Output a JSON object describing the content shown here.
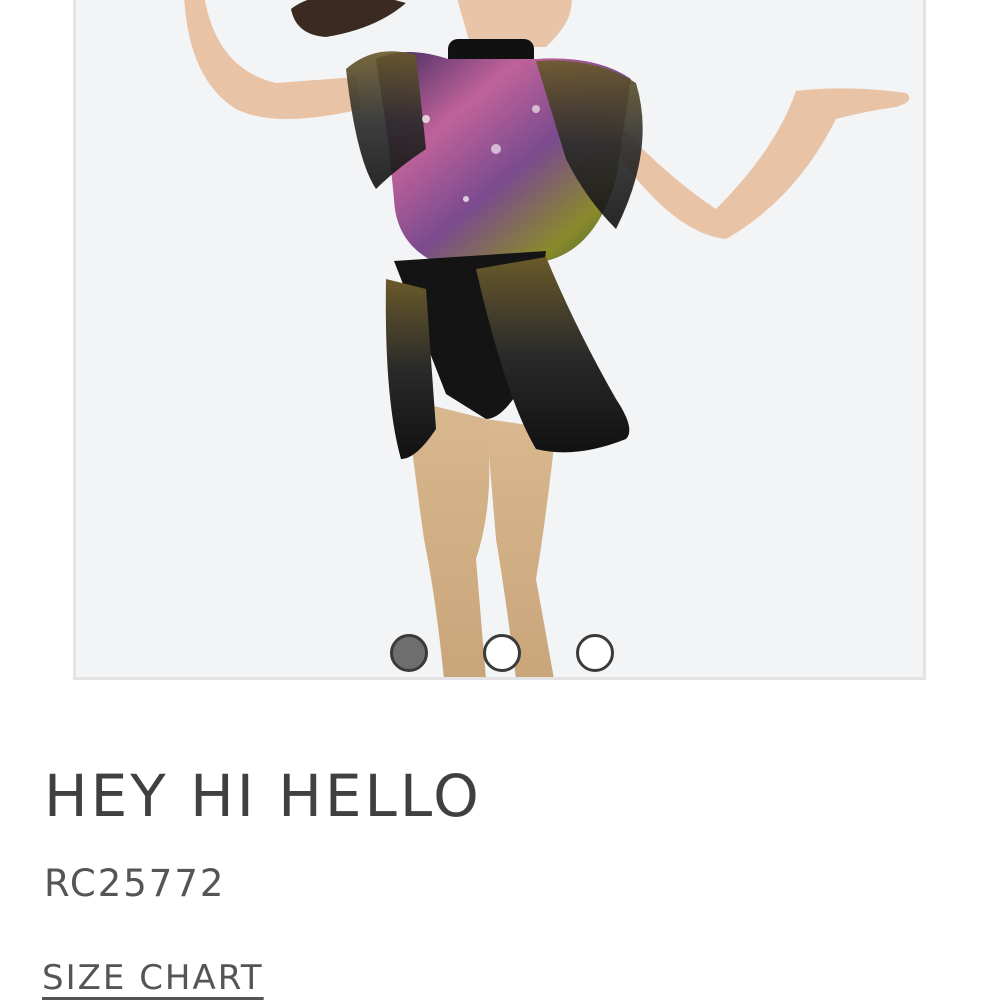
{
  "product": {
    "title": "HEY HI HELLO",
    "sku": "RC25772",
    "size_chart_label": "SIZE CHART"
  },
  "gallery": {
    "image_count": 3,
    "active_index": 0,
    "dots": [
      {
        "state": "active"
      },
      {
        "state": "inactive"
      },
      {
        "state": "inactive"
      }
    ]
  },
  "colors": {
    "background": "#ffffff",
    "gallery_background": "#f3f4f6",
    "text": "#404040",
    "dot_active": "#6e6e6e"
  }
}
